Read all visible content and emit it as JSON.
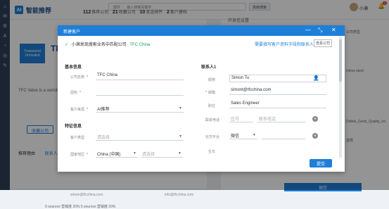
{
  "rail": {
    "icons": [
      "home-icon",
      "mail-icon",
      "gear-icon",
      "ai-icon",
      "chart-icon",
      "globe-icon",
      "tools-icon"
    ]
  },
  "topbar": {
    "brand_mark": "AI",
    "brand": "智能推荐",
    "stats": [
      {
        "n": "112",
        "label": "推荐公司"
      },
      {
        "n": "21",
        "label": "收藏公司"
      },
      {
        "n": "10",
        "label": "发送邮件"
      },
      {
        "n": "2",
        "label": "客户建档"
      }
    ],
    "filter_label": "部件",
    "filter_placeholder": "输入搜索关键字",
    "search_label": "高级搜索",
    "user_name": "小满",
    "notice_count": "3"
  },
  "company": {
    "logo_text": "Transcend Unrivaled",
    "big_title": "TFC",
    "desc": "TFC Valve is a worldw",
    "collect": "收藏公司",
    "tabs": [
      "推荐理由",
      "联系人"
    ],
    "email1": "simon@tfcchina.com",
    "email2": "info@tfcchina.com",
    "metrics": "0 sources    营销度 20%                5 sources    营销度 20%"
  },
  "right_panel": {
    "title": "开发信设置",
    "side1": "公司类型",
    "side2": "inless steel",
    "side3": "Didtek_Good_Quality_Int",
    "side4": "选择",
    "save": "保存"
  },
  "modal": {
    "title": "新建客户",
    "notice_text": "小满发现搜索业务中匹配公司",
    "notice_company": "TFC China",
    "notice_link": "需要填写客户资料字段和联系人",
    "notice_btn": "查看公司",
    "basic_title": "基本信息",
    "special_title": "特征信息",
    "labels": {
      "company_name": "公司名称",
      "tag": "团标",
      "source": "客户来源",
      "customer_type": "客户类型",
      "country": "国家地区"
    },
    "values": {
      "company_name": "TFC China",
      "tag": "",
      "source": "AI推荐",
      "customer_type": "请选择",
      "country": "China (中国)",
      "country2": "请选择"
    },
    "contact_title": "联系人1",
    "contact_labels": {
      "name": "昵称",
      "email": "邮箱",
      "position": "职位",
      "phone": "联系电话",
      "social": "社交平台",
      "birthday": "生日"
    },
    "contact_values": {
      "name": "Simon Tu",
      "email": "simont@tfcchina.com",
      "position": "Sales Engineer",
      "phone_area": "区号",
      "phone_num": "联系电话",
      "social_platform": "微信",
      "social_account": ""
    },
    "submit": "提交"
  }
}
